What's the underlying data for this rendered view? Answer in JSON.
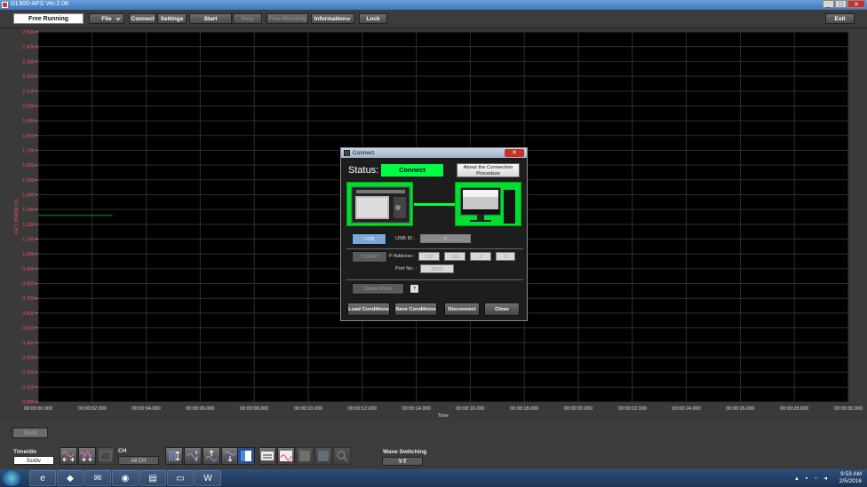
{
  "window": {
    "title": "GL900-APS Ver.2.06"
  },
  "toolbar": {
    "mode": "Free Running",
    "file": "File",
    "connect": "Connect",
    "settings": "Settings",
    "start": "Start",
    "stop": "Stop",
    "free_running": "Free Running",
    "information": "Information",
    "lock": "Lock",
    "exit": "Exit"
  },
  "chart_data": {
    "type": "line",
    "ylabel": "CH 1 [ISEM]  (V)",
    "xlabel": "Time",
    "ylim": [
      0.0,
      2.5
    ],
    "yticks": [
      "2.500",
      "2.400",
      "2.300",
      "2.200",
      "2.100",
      "2.000",
      "1.900",
      "1.800",
      "1.700",
      "1.600",
      "1.500",
      "1.400",
      "1.300",
      "1.200",
      "1.100",
      "1.000",
      "0.900",
      "0.800",
      "0.700",
      "0.600",
      "0.500",
      "0.400",
      "0.300",
      "0.200",
      "0.100",
      "0.000"
    ],
    "xticks": [
      "00:00:00.000",
      "00:00:02.000",
      "00:00:04.000",
      "00:00:06.000",
      "00:00:08.000",
      "00:00:10.000",
      "00:00:12.000",
      "00:00:14.000",
      "00:00:16.000",
      "00:00:18.000",
      "00:00:20.000",
      "00:00:22.000",
      "00:00:24.000",
      "00:00:26.000",
      "00:00:28.000",
      "00:00:30.000"
    ],
    "xlim_seconds": [
      0,
      30
    ],
    "grid": true,
    "series": [
      {
        "color": "#2e8b2e",
        "x": [
          0,
          2.75
        ],
        "y": [
          1.26,
          1.26
        ]
      }
    ]
  },
  "bottom": {
    "scroll": "Scroll",
    "time_div_label": "Time/div",
    "time_div_value": "5s/div",
    "ch_label": "CH",
    "ch_value": "All CH",
    "wave_switching_label": "Wave Switching",
    "wave_switching_value": "Y-T"
  },
  "dialog": {
    "title": "Connect",
    "status_label": "Status:",
    "status_value": "Connect",
    "about": "About the Connection Procedure",
    "usb": "USB",
    "usb_id_label": "USB ID :",
    "usb_id_value": "0",
    "tcpip": "TCP/IP",
    "ip_label": "P Address :",
    "ip": [
      "192",
      "168",
      "0",
      "1"
    ],
    "port_label": "Port No. :",
    "port_value": "8023",
    "demo": "Demo Mode",
    "help": "?",
    "load": "Load Conditions",
    "save": "Save Conditions",
    "disconnect": "Disconnect",
    "close": "Close"
  },
  "taskbar": {
    "time": "9:53 AM",
    "date": "2/5/2016"
  },
  "colors": {
    "plot_bg": "#000000",
    "grid": "#2f2f2f",
    "tick_text": "#ff5050",
    "status_green": "#00ff44"
  }
}
